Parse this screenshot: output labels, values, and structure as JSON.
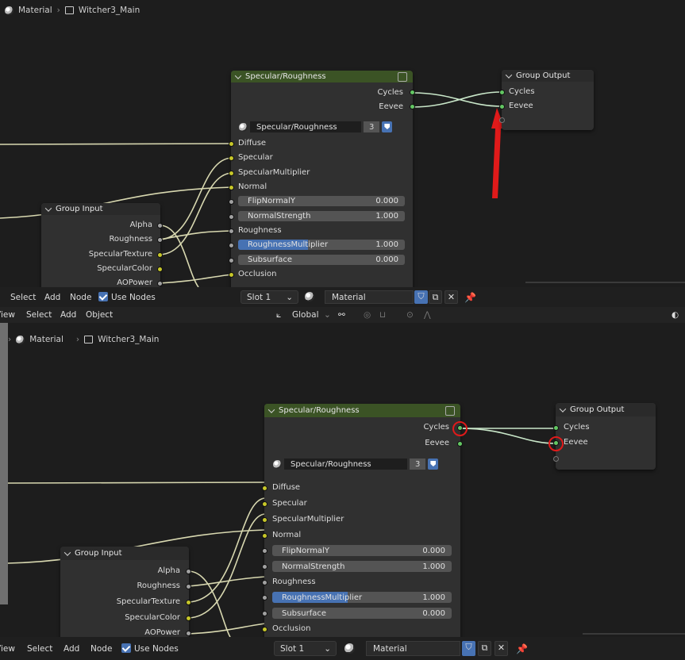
{
  "breadcrumb": {
    "material": "Material",
    "group": "Witcher3_Main"
  },
  "spec_node": {
    "title": "Specular/Roughness",
    "users": "3",
    "outputs": [
      "Cycles",
      "Eevee"
    ],
    "group_name": "Specular/Roughness",
    "group_users": "3",
    "inputs": {
      "diffuse": "Diffuse",
      "specular": "Specular",
      "specular_multiplier": "SpecularMultiplier",
      "normal": "Normal",
      "flip_normal_y": {
        "label": "FlipNormalY",
        "value": "0.000"
      },
      "normal_strength": {
        "label": "NormalStrength",
        "value": "1.000"
      },
      "roughness": "Roughness",
      "roughness_multiplier": {
        "label": "RoughnessMultiplier",
        "value": "1.000",
        "fraction": 0.42
      },
      "subsurface": {
        "label": "Subsurface",
        "value": "0.000"
      },
      "occlusion": "Occlusion"
    }
  },
  "group_output": {
    "title": "Group Output",
    "cycles": "Cycles",
    "eevee": "Eevee"
  },
  "group_input": {
    "title": "Group Input",
    "outputs": [
      "Alpha",
      "Roughness",
      "SpecularTexture",
      "SpecularColor",
      "AOPower"
    ]
  },
  "node_header": {
    "select": "Select",
    "add": "Add",
    "node": "Node",
    "use_nodes": "Use Nodes",
    "slot": "Slot 1",
    "material": "Material"
  },
  "viewport_header": {
    "view": "View",
    "select": "Select",
    "add": "Add",
    "object": "Object",
    "orientation": "Global"
  },
  "colors": {
    "accent": "#4772b3",
    "node_header_green": "#3b5325",
    "socket_yellow": "#c7c729",
    "socket_green": "#63c763",
    "annotation_red": "#e01a1a"
  }
}
